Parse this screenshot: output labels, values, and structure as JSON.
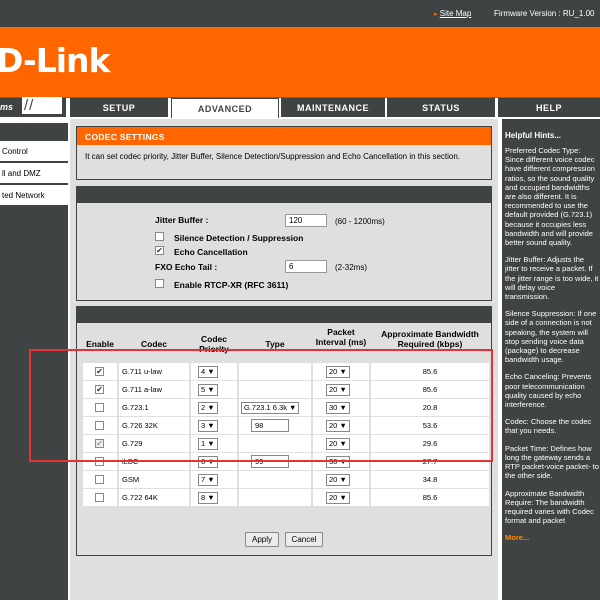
{
  "topbar": {
    "site_map": "Site Map",
    "firmware": "Firmware Version : RU_1.00"
  },
  "logo": "D-Link",
  "product_tab": "ms",
  "tabs": [
    "SETUP",
    "ADVANCED",
    "MAINTENANCE",
    "STATUS",
    "HELP"
  ],
  "active_tab": "ADVANCED",
  "sidebar": {
    "items": [
      "Control",
      "ll and DMZ",
      "ted Network"
    ]
  },
  "codec_settings": {
    "title": "CODEC SETTINGS",
    "intro": "It can set codec priority, Jitter Buffer, Silence Detection/Suppression and Echo Cancellation in this section."
  },
  "voice_settings": {
    "jitter_label": "Jitter Buffer :",
    "jitter_value": "120",
    "jitter_hint": "(60 - 1200ms)",
    "silence_label": "Silence Detection / Suppression",
    "silence_checked": false,
    "echo_label": "Echo Cancellation",
    "echo_checked": true,
    "fxo_label": "FXO Echo Tail :",
    "fxo_value": "6",
    "fxo_hint": "(2-32ms)",
    "rtcp_label": "Enable RTCP-XR (RFC 3611)",
    "rtcp_checked": false
  },
  "codec_table": {
    "headers": {
      "enable": "Enable",
      "codec": "Codec",
      "priority": "Codec Priority",
      "type": "Type",
      "packet": "Packet Interval (ms)",
      "bandwidth": "Approximate Bandwidth Required (kbps)"
    },
    "rows": [
      {
        "enabled": true,
        "codec": "G.711 u-law",
        "priority": "4",
        "type_kind": "none",
        "type": "",
        "interval": "20",
        "bandwidth": "85.6"
      },
      {
        "enabled": true,
        "codec": "G.711 a-law",
        "priority": "5",
        "type_kind": "none",
        "type": "",
        "interval": "20",
        "bandwidth": "85.6"
      },
      {
        "enabled": false,
        "codec": "G.723.1",
        "priority": "2",
        "type_kind": "select",
        "type": "G.723.1 6.3k",
        "interval": "30",
        "bandwidth": "20.8"
      },
      {
        "enabled": false,
        "codec": "G.726 32K",
        "priority": "3",
        "type_kind": "input",
        "type": "98",
        "interval": "20",
        "bandwidth": "53.6"
      },
      {
        "enabled": true,
        "codec": "G.729",
        "priority": "1",
        "type_kind": "none",
        "type": "",
        "interval": "20",
        "bandwidth": "29.6",
        "disabled_look": true
      },
      {
        "enabled": false,
        "codec": "iLBC",
        "priority": "6",
        "type_kind": "input",
        "type": "99",
        "interval": "30",
        "bandwidth": "27.7"
      },
      {
        "enabled": false,
        "codec": "GSM",
        "priority": "7",
        "type_kind": "none",
        "type": "",
        "interval": "20",
        "bandwidth": "34.8"
      },
      {
        "enabled": false,
        "codec": "G.722 64K",
        "priority": "8",
        "type_kind": "none",
        "type": "",
        "interval": "20",
        "bandwidth": "85.6"
      }
    ]
  },
  "buttons": {
    "apply": "Apply",
    "cancel": "Cancel"
  },
  "help": {
    "title": "Helpful Hints...",
    "paragraphs": [
      "Preferred Codec Type: Since different voice codec have different compression ratios, so the sound quality and occupied bandwidths are also different. It is recommended to use the default provided (G.723.1) because it occupies less bandwidth and will provide better sound quality.",
      "Jitter Buffer: Adjusts the jitter to receive a packet. If the jitter range is too wide, it will delay voice transmission.",
      "Silence Suppression: If one side of a connection is not speaking, the system will stop sending voice data (package) to decrease bandwidth usage.",
      "Echo Canceling: Prevents poor telecommunication quality caused by echo interference.",
      "Codec: Choose the codec that you needs.",
      "Packet Time: Defines how long the gateway sends a RTP packet-voice packet- to the other side.",
      "Approximate Bandwidth Require: The bandwidth required varies with Codec format and packet"
    ],
    "more": "More..."
  },
  "colors": {
    "brand_orange": "#ff6600",
    "dark_gray": "#404343",
    "panel_gray": "#dfdfdf",
    "highlight_red": "#e53333"
  }
}
